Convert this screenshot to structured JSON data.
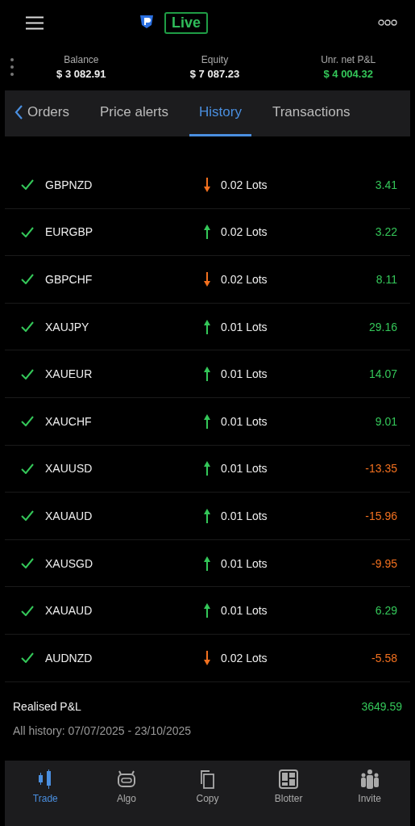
{
  "header": {
    "badge": "Live"
  },
  "summary": [
    {
      "label": "Balance",
      "value": "$ 3 082.91",
      "positive": false
    },
    {
      "label": "Equity",
      "value": "$ 7 087.23",
      "positive": false
    },
    {
      "label": "Unr. net P&L",
      "value": "$ 4 004.32",
      "positive": true
    }
  ],
  "tabs": [
    {
      "label": "Orders",
      "selected": false
    },
    {
      "label": "Price alerts",
      "selected": false
    },
    {
      "label": "History",
      "selected": true
    },
    {
      "label": "Transactions",
      "selected": false
    }
  ],
  "rows": [
    {
      "symbol": "GBPNZD",
      "kind": "down",
      "lots": "0.02 Lots",
      "pnl": "3.41",
      "positive": true
    },
    {
      "symbol": "EURGBP",
      "kind": "up",
      "lots": "0.02 Lots",
      "pnl": "3.22",
      "positive": true
    },
    {
      "symbol": "GBPCHF",
      "kind": "down",
      "lots": "0.02 Lots",
      "pnl": "8.11",
      "positive": true
    },
    {
      "symbol": "XAUJPY",
      "kind": "up",
      "lots": "0.01 Lots",
      "pnl": "29.16",
      "positive": true
    },
    {
      "symbol": "XAUEUR",
      "kind": "up",
      "lots": "0.01 Lots",
      "pnl": "14.07",
      "positive": true
    },
    {
      "symbol": "XAUCHF",
      "kind": "up",
      "lots": "0.01 Lots",
      "pnl": "9.01",
      "positive": true
    },
    {
      "symbol": "XAUUSD",
      "kind": "up",
      "lots": "0.01 Lots",
      "pnl": "-13.35",
      "positive": false
    },
    {
      "symbol": "XAUAUD",
      "kind": "up",
      "lots": "0.01 Lots",
      "pnl": "-15.96",
      "positive": false
    },
    {
      "symbol": "XAUSGD",
      "kind": "up",
      "lots": "0.01 Lots",
      "pnl": "-9.95",
      "positive": false
    },
    {
      "symbol": "XAUAUD",
      "kind": "up",
      "lots": "0.01 Lots",
      "pnl": "6.29",
      "positive": true
    },
    {
      "symbol": "AUDNZD",
      "kind": "down",
      "lots": "0.02 Lots",
      "pnl": "-5.58",
      "positive": false
    }
  ],
  "realised": {
    "label": "Realised P&L",
    "value": "3649.59",
    "positive": true,
    "range": "All history: 07/07/2025 - 23/10/2025"
  },
  "nav": [
    {
      "kind": "trade",
      "label": "Trade",
      "selected": true
    },
    {
      "kind": "algo",
      "label": "Algo",
      "selected": false
    },
    {
      "kind": "copy",
      "label": "Copy",
      "selected": false
    },
    {
      "kind": "blotter",
      "label": "Blotter",
      "selected": false
    },
    {
      "kind": "invite",
      "label": "Invite",
      "selected": false
    }
  ]
}
